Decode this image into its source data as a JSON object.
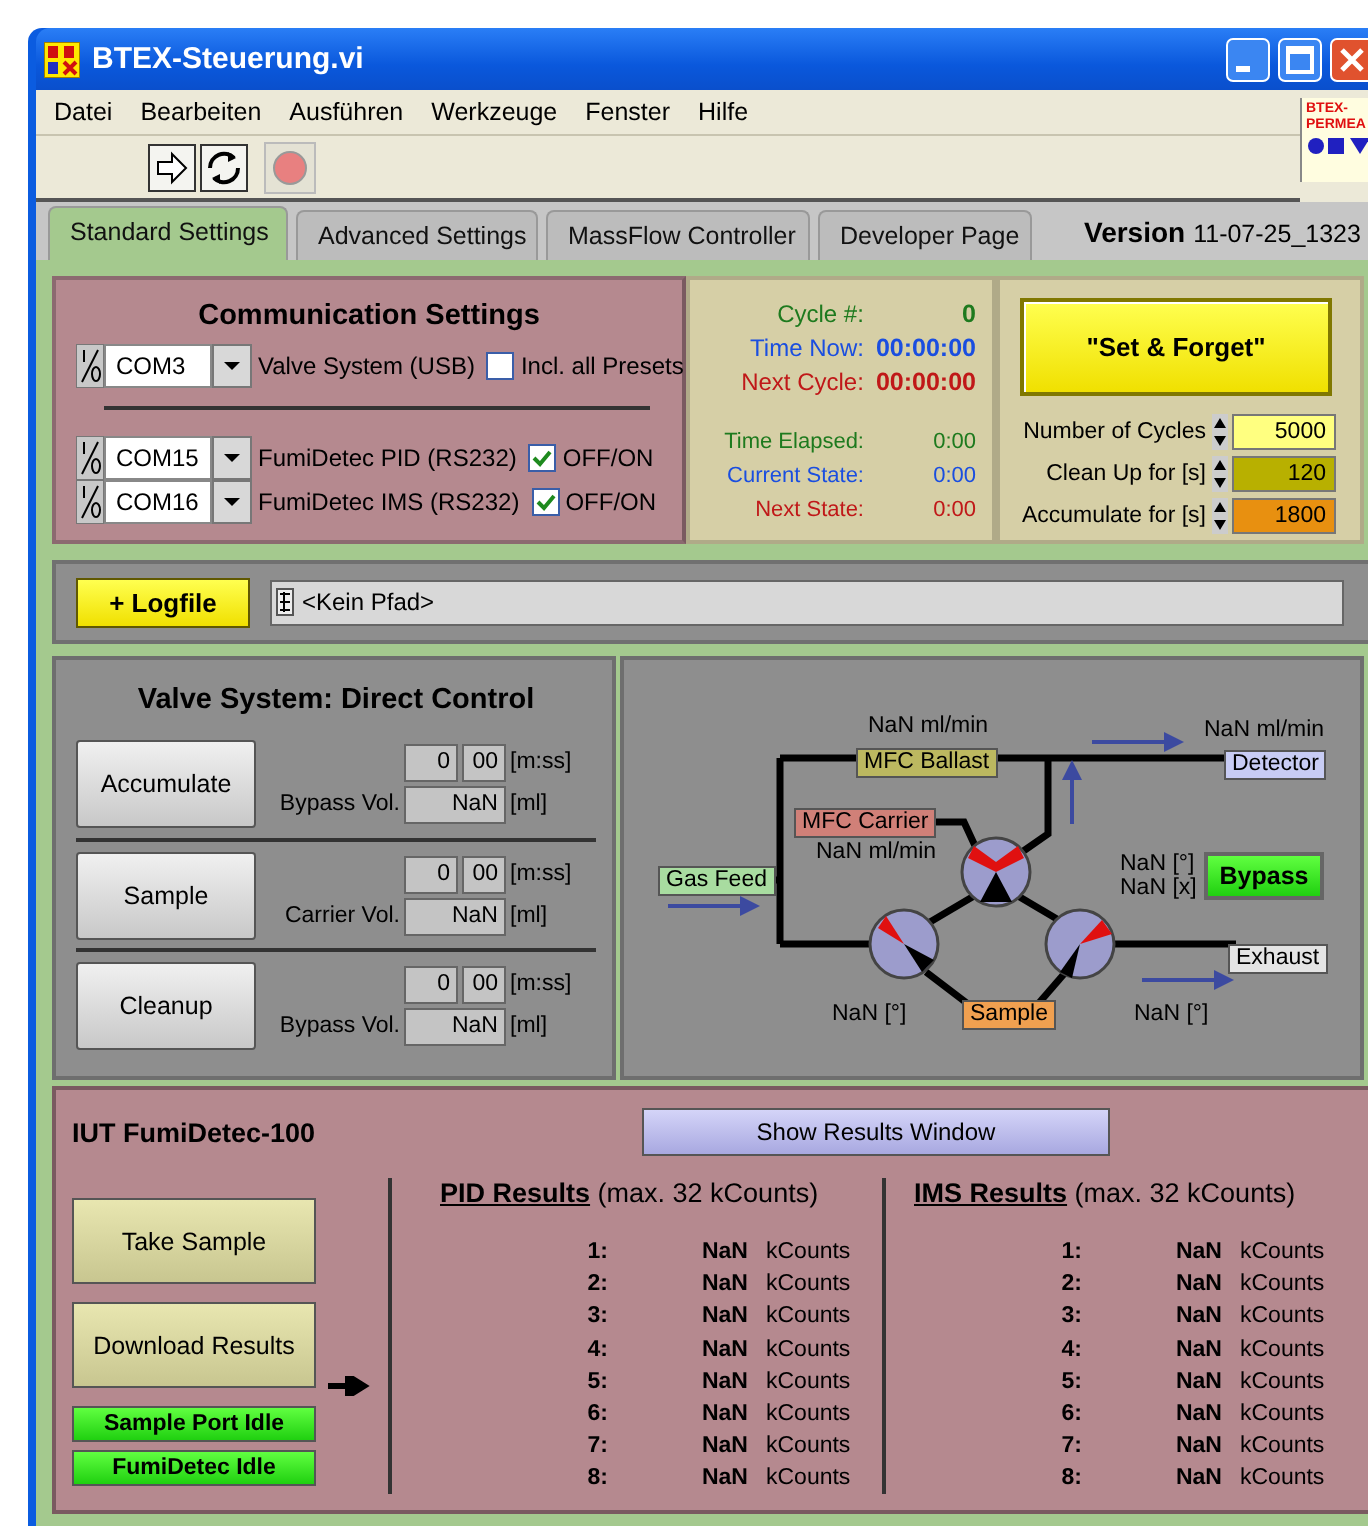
{
  "window": {
    "title": "BTEX-Steuerung.vi"
  },
  "menu": [
    "Datei",
    "Bearbeiten",
    "Ausführen",
    "Werkzeuge",
    "Fenster",
    "Hilfe"
  ],
  "vi_icon": {
    "lines": [
      "BTEX-",
      "PERMEA"
    ]
  },
  "tabs": [
    {
      "label": "Standard Settings",
      "selected": true
    },
    {
      "label": "Advanced Settings",
      "selected": false
    },
    {
      "label": "MassFlow Controller",
      "selected": false
    },
    {
      "label": "Developer Page",
      "selected": false
    }
  ],
  "version": {
    "label": "Version",
    "value": "11-07-25_1323"
  },
  "communication": {
    "title": "Communication Settings",
    "ports": [
      {
        "port": "COM3",
        "label": "Valve System (USB)",
        "option": "Incl. all Presets",
        "checked": false
      },
      {
        "port": "COM15",
        "label": "FumiDetec PID (RS232)",
        "option": "OFF/ON",
        "checked": true
      },
      {
        "port": "COM16",
        "label": "FumiDetec IMS (RS232)",
        "option": "OFF/ON",
        "checked": true
      }
    ]
  },
  "schedule": [
    {
      "label": "Cycle #:",
      "value": "0",
      "color": "#1e7a1e"
    },
    {
      "label": "Time Now:",
      "value": "00:00:00",
      "color": "#1a4ee0"
    },
    {
      "label": "Next Cycle:",
      "value": "00:00:00",
      "color": "#c01818"
    }
  ],
  "timers": [
    {
      "label": "Time Elapsed:",
      "value": "0:00",
      "color": "#1e7a1e"
    },
    {
      "label": "Current State:",
      "value": "0:00",
      "color": "#1a4ee0"
    },
    {
      "label": "Next State:",
      "value": "0:00",
      "color": "#c01818"
    }
  ],
  "set_and_forget": {
    "button": "\"Set & Forget\"",
    "settings": [
      {
        "label": "Number of Cycles",
        "value": "5000",
        "color": "#ffff80"
      },
      {
        "label": "Clean Up for [s]",
        "value": "120",
        "color": "#b8b000"
      },
      {
        "label": "Accumulate for [s]",
        "value": "1800",
        "color": "#e89010"
      }
    ]
  },
  "logfile": {
    "button": "+ Logfile",
    "path": "<Kein Pfad>"
  },
  "valve_control": {
    "title": "Valve System: Direct Control",
    "modes": [
      {
        "button": "Accumulate",
        "minutes": "0",
        "seconds": "00",
        "time_unit": "[m:ss]",
        "volume_label": "Bypass Vol.",
        "volume": "NaN",
        "volume_unit": "[ml]"
      },
      {
        "button": "Sample",
        "minutes": "0",
        "seconds": "00",
        "time_unit": "[m:ss]",
        "volume_label": "Carrier Vol.",
        "volume": "NaN",
        "volume_unit": "[ml]"
      },
      {
        "button": "Cleanup",
        "minutes": "0",
        "seconds": "00",
        "time_unit": "[m:ss]",
        "volume_label": "Bypass Vol.",
        "volume": "NaN",
        "volume_unit": "[ml]"
      }
    ]
  },
  "flow_diagram": {
    "nodes": [
      {
        "label": "Gas Feed",
        "color": "#a8dca0"
      },
      {
        "label": "MFC Ballast",
        "color": "#bcb860"
      },
      {
        "label": "MFC Carrier",
        "color": "#d08078"
      },
      {
        "label": "Detector",
        "color": "#c8ccf4"
      },
      {
        "label": "Exhaust",
        "color": "#e4e4e4"
      },
      {
        "label": "Sample",
        "color": "#f0a050"
      }
    ],
    "readouts": [
      "NaN ml/min",
      "NaN ml/min",
      "NaN ml/min",
      "NaN [°]",
      "NaN [x]",
      "NaN [°]",
      "NaN [°]"
    ],
    "bypass": {
      "label": "Bypass",
      "on": true
    }
  },
  "fumidetec": {
    "title": "IUT FumiDetec-100",
    "show_button": "Show Results Window",
    "buttons": [
      "Take Sample",
      "Download Results"
    ],
    "indicators": [
      {
        "label": "Sample Port Idle",
        "on": true
      },
      {
        "label": "FumiDetec Idle",
        "on": true
      }
    ],
    "results": [
      {
        "title": "PID Results",
        "note": "(max. 32 kCounts)",
        "rows": [
          {
            "index": "1:",
            "value": "NaN",
            "unit": "kCounts"
          },
          {
            "index": "2:",
            "value": "NaN",
            "unit": "kCounts"
          },
          {
            "index": "3:",
            "value": "NaN",
            "unit": "kCounts"
          },
          {
            "index": "4:",
            "value": "NaN",
            "unit": "kCounts"
          },
          {
            "index": "5:",
            "value": "NaN",
            "unit": "kCounts"
          },
          {
            "index": "6:",
            "value": "NaN",
            "unit": "kCounts"
          },
          {
            "index": "7:",
            "value": "NaN",
            "unit": "kCounts"
          },
          {
            "index": "8:",
            "value": "NaN",
            "unit": "kCounts"
          }
        ]
      },
      {
        "title": "IMS Results",
        "note": "(max. 32 kCounts)",
        "rows": [
          {
            "index": "1:",
            "value": "NaN",
            "unit": "kCounts"
          },
          {
            "index": "2:",
            "value": "NaN",
            "unit": "kCounts"
          },
          {
            "index": "3:",
            "value": "NaN",
            "unit": "kCounts"
          },
          {
            "index": "4:",
            "value": "NaN",
            "unit": "kCounts"
          },
          {
            "index": "5:",
            "value": "NaN",
            "unit": "kCounts"
          },
          {
            "index": "6:",
            "value": "NaN",
            "unit": "kCounts"
          },
          {
            "index": "7:",
            "value": "NaN",
            "unit": "kCounts"
          },
          {
            "index": "8:",
            "value": "NaN",
            "unit": "kCounts"
          }
        ]
      }
    ]
  }
}
